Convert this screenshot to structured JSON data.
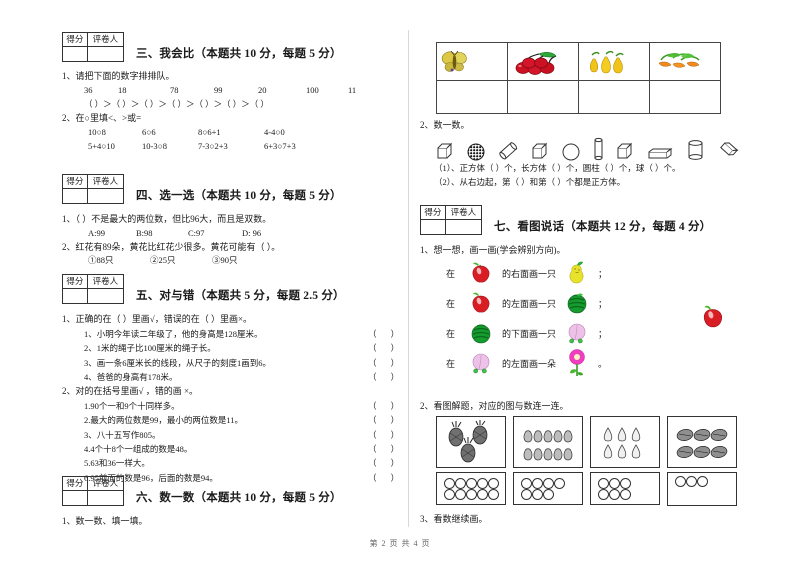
{
  "document": {
    "footer": "第 2 页 共 4 页",
    "score_box": {
      "score_label": "得分",
      "grader_label": "评卷人"
    }
  },
  "sections": [
    {
      "id": "three",
      "title": "三、我会比（本题共 10 分，每题 5 分）",
      "questions": [
        {
          "num": "1、",
          "text": "请把下面的数字排排队。"
        },
        {
          "numbers": [
            "36",
            "18",
            "78",
            "99",
            "20",
            "100",
            "11"
          ]
        },
        {
          "blank_chain": "（   ）＞（   ）＞（   ）＞（   ）＞（  ）＞（   ）＞（  ）"
        },
        {
          "num": "2、",
          "text": "在○里填<、>或="
        },
        {
          "row": [
            "10○8",
            "6○6",
            "8○6+1",
            "4-4○0"
          ]
        },
        {
          "row": [
            "5+4○10",
            "10-3○8",
            "7-3○2+3",
            "6+3○7+3"
          ]
        }
      ]
    },
    {
      "id": "four",
      "title": "四、选一选（本题共 10 分，每题 5 分）",
      "questions": [
        {
          "num": "1、",
          "text": "（    ）不是最大的两位数，但比96大，而且是双数。"
        },
        {
          "options": [
            "A:99",
            "B:98",
            "C:97",
            "D: 96"
          ]
        },
        {
          "num": "2、",
          "text": "红花有89朵，黄花比红花少很多。黄花可能有（    ）。"
        },
        {
          "options": [
            "①88只",
            "②25只",
            "③90只"
          ]
        }
      ]
    },
    {
      "id": "five",
      "title": "五、对与错（本题共 5 分，每题 2.5 分）",
      "questions": [
        {
          "num": "1、",
          "text": "正确的在（    ）里画√，错误的在（    ）里画×。"
        },
        {
          "item": "1、小明今年读二年级了，他的身高是128厘米。",
          "answer": "（    ）"
        },
        {
          "item": "2、1米的绳子比100厘米的绳子长。",
          "answer": "（    ）"
        },
        {
          "item": "3、画一条6厘米长的线段，从尺子的刻度1画到6。",
          "answer": "（    ）"
        },
        {
          "item": "4、爸爸的身高有178米。",
          "answer": "（    ）"
        },
        {
          "num": "2、",
          "text": "对的在括号里画√ ，错的画 ×。"
        },
        {
          "item": "1.90个一和9个十同样多。",
          "answer": "（    ）"
        },
        {
          "item": "2.最大的两位数是99，最小的两位数是11。",
          "answer": "（    ）"
        },
        {
          "item": "3、八十五写作805。",
          "answer": "（    ）"
        },
        {
          "item": "4.4个十8个一组成的数是48。",
          "answer": "（    ）"
        },
        {
          "item": "5.63和36一样大。",
          "answer": "（    ）"
        },
        {
          "item": "6.95前面的数是96，后面的数是94。",
          "answer": "（    ）"
        }
      ]
    },
    {
      "id": "six",
      "title": "六、数一数（本题共 10 分，每题 5 分）",
      "questions": [
        {
          "num": "1、",
          "text": "数一数、填一填。"
        },
        {
          "num": "2、",
          "text": "数一数。"
        },
        {
          "blank1": "（1）、正方体（     ）个，长方体（     ）个，圆柱（    ）个，球（     ）个。"
        },
        {
          "blank2": "（2）、从右边起，第（     ）和第（     ）个都是正方体。"
        }
      ],
      "picture_table": [
        {
          "name": "butterfly-picture"
        },
        {
          "name": "cherries-picture"
        },
        {
          "name": "pears-picture"
        },
        {
          "name": "carrots-picture"
        }
      ],
      "shapes": [
        "cube",
        "sphere-textured",
        "cylinder-tilted",
        "cube",
        "sphere",
        "cylinder-tall",
        "cube",
        "cuboid-flat",
        "cylinder",
        "cuboid-tilted"
      ]
    },
    {
      "id": "seven",
      "title": "七、看图说话（本题共 12 分，每题 4 分）",
      "questions": [
        {
          "num": "1、",
          "text": "想一想，画一画(学会辨别方向)。"
        },
        {
          "prefix": "在",
          "subject": "apple",
          "middle": "的右面画一只",
          "object": "pear",
          "suffix": "；"
        },
        {
          "prefix": "在",
          "subject": "apple",
          "middle": "的左面画一只",
          "object": "watermelon",
          "suffix": "；"
        },
        {
          "prefix": "在",
          "subject": "watermelon",
          "middle": "的下面画一只",
          "object": "peach",
          "suffix": "；"
        },
        {
          "prefix": "在",
          "subject": "peach",
          "middle": "的左面画一朵",
          "object": "flower",
          "suffix": "。"
        },
        {
          "num": "2、",
          "text": "看图解题，对应的图与数连一连。"
        },
        {
          "num": "3、",
          "text": "看数继续画。"
        }
      ],
      "count_boxes_top": [
        {
          "item": "pineapple",
          "count": 3
        },
        {
          "item": "onion",
          "count": 10
        },
        {
          "item": "garlic",
          "count": 7
        },
        {
          "item": "nut",
          "count": 6
        }
      ],
      "count_boxes_bottom": [
        {
          "count": 10
        },
        {
          "count": 7
        },
        {
          "count": 6
        },
        {
          "count": 3
        }
      ]
    }
  ],
  "colors": {
    "apple_red": "#d81e24",
    "pear_yellow": "#e8e22a",
    "watermelon_green": "#169b2e",
    "peach_pink": "#eec2e8",
    "flower_pink": "#f03fbe",
    "carrot_orange": "#f08a1e",
    "cherry_red": "#cc1122",
    "butterfly_gold": "#d9c040",
    "pear_gold": "#f0c419",
    "line": "#333333"
  }
}
